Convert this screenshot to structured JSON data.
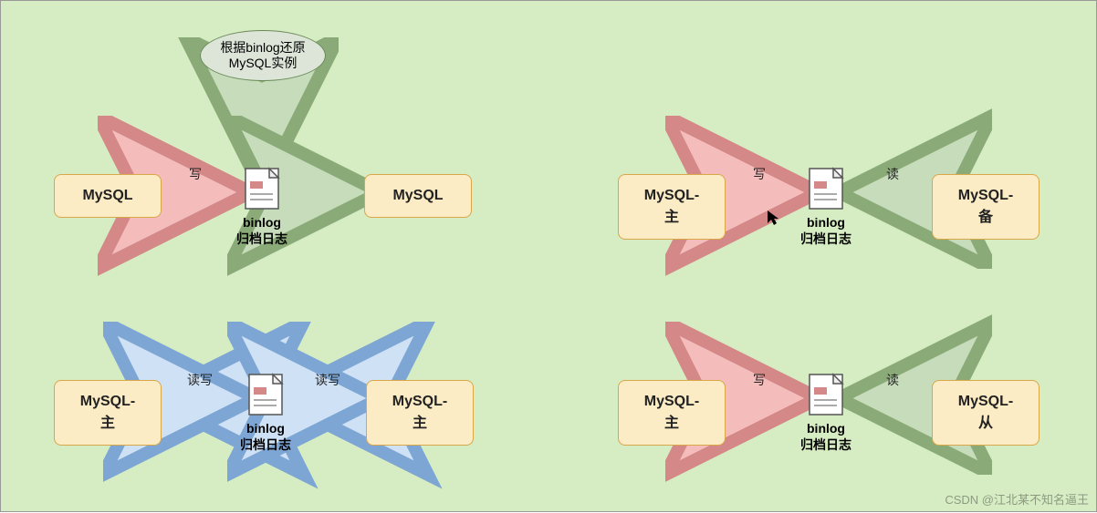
{
  "diagram": {
    "ellipse": {
      "text": "根据binlog还原\nMySQL实例"
    },
    "doc": {
      "title": "binlog",
      "subtitle": "归档日志"
    },
    "q1": {
      "left": "MySQL",
      "right": "MySQL",
      "arrow1_label": "写"
    },
    "q2": {
      "left": "MySQL-主",
      "right": "MySQL-备",
      "arrow1_label": "写",
      "arrow2_label": "读"
    },
    "q3": {
      "left": "MySQL-主",
      "right": "MySQL-主",
      "arrow1_label": "读写",
      "arrow2_label": "读写"
    },
    "q4": {
      "left": "MySQL-主",
      "right": "MySQL-从",
      "arrow1_label": "写",
      "arrow2_label": "读"
    },
    "watermark": "CSDN @江北某不知名逼王"
  }
}
